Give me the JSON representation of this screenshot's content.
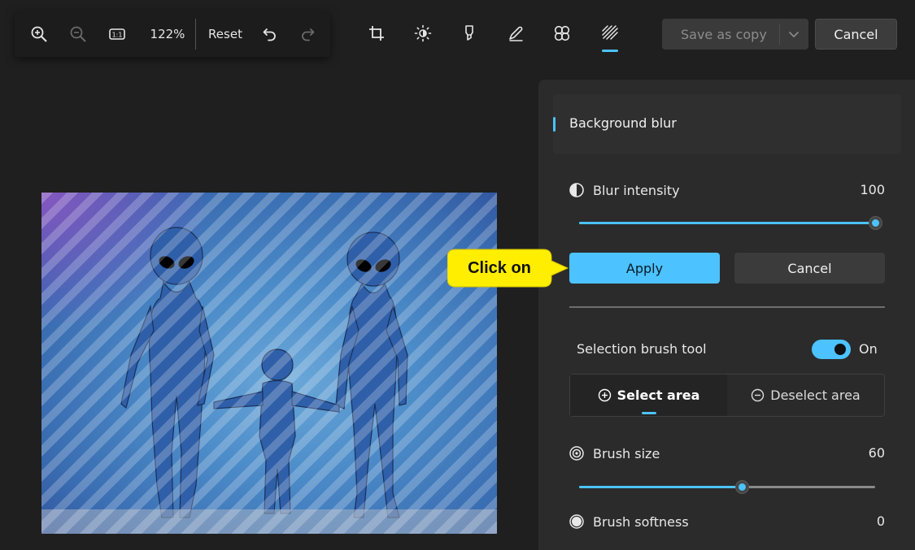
{
  "toolbar": {
    "zoom_level": "122%",
    "reset_label": "Reset",
    "save_as_copy_label": "Save as copy",
    "cancel_label": "Cancel"
  },
  "panel": {
    "section_title": "Background blur",
    "blur_intensity": {
      "label": "Blur intensity",
      "value": "100",
      "fraction": 1.0
    },
    "apply_label": "Apply",
    "cancel_label": "Cancel",
    "selection_brush": {
      "label": "Selection brush tool",
      "state": "On"
    },
    "select_area_label": "Select area",
    "deselect_area_label": "Deselect area",
    "brush_size": {
      "label": "Brush size",
      "value": "60",
      "fraction": 0.55
    },
    "brush_softness": {
      "label": "Brush softness",
      "value": "0"
    }
  },
  "callout": {
    "text": "Click on"
  },
  "colors": {
    "accent": "#4cc2ff",
    "callout": "#ffee00",
    "background": "#1f1f1f"
  },
  "icons": [
    "zoom-in-icon",
    "zoom-out-icon",
    "actual-size-icon",
    "undo-icon",
    "redo-icon",
    "crop-icon",
    "brightness-icon",
    "marker-icon",
    "draw-icon",
    "filters-icon",
    "background-blur-icon",
    "chevron-down-icon",
    "blur-intensity-icon",
    "select-area-icon",
    "deselect-area-icon",
    "brush-size-icon",
    "brush-softness-icon"
  ]
}
